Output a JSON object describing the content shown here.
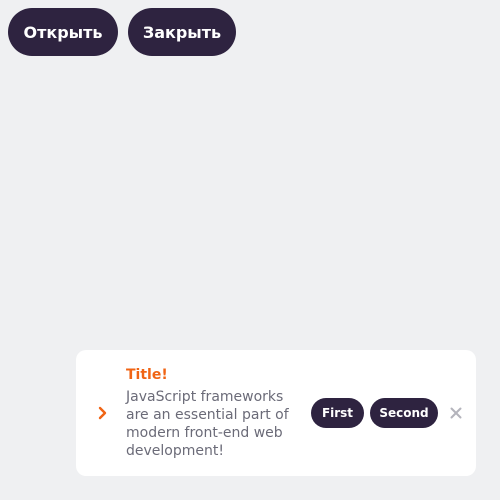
{
  "controls": {
    "open_label": "Открыть",
    "close_label": "Закрыть"
  },
  "toast": {
    "title": "Title!",
    "message": "JavaScript frameworks are an essential part of modern front-end web development!",
    "actions": [
      {
        "label": "First"
      },
      {
        "label": "Second"
      }
    ],
    "icons": {
      "leading": "chevron-right-icon",
      "dismiss": "close-icon"
    }
  },
  "colors": {
    "background": "#eff0f2",
    "button": "#2e2340",
    "accent": "#f06414",
    "text_muted": "#6b6b78",
    "close_icon": "#b4b4bc"
  }
}
